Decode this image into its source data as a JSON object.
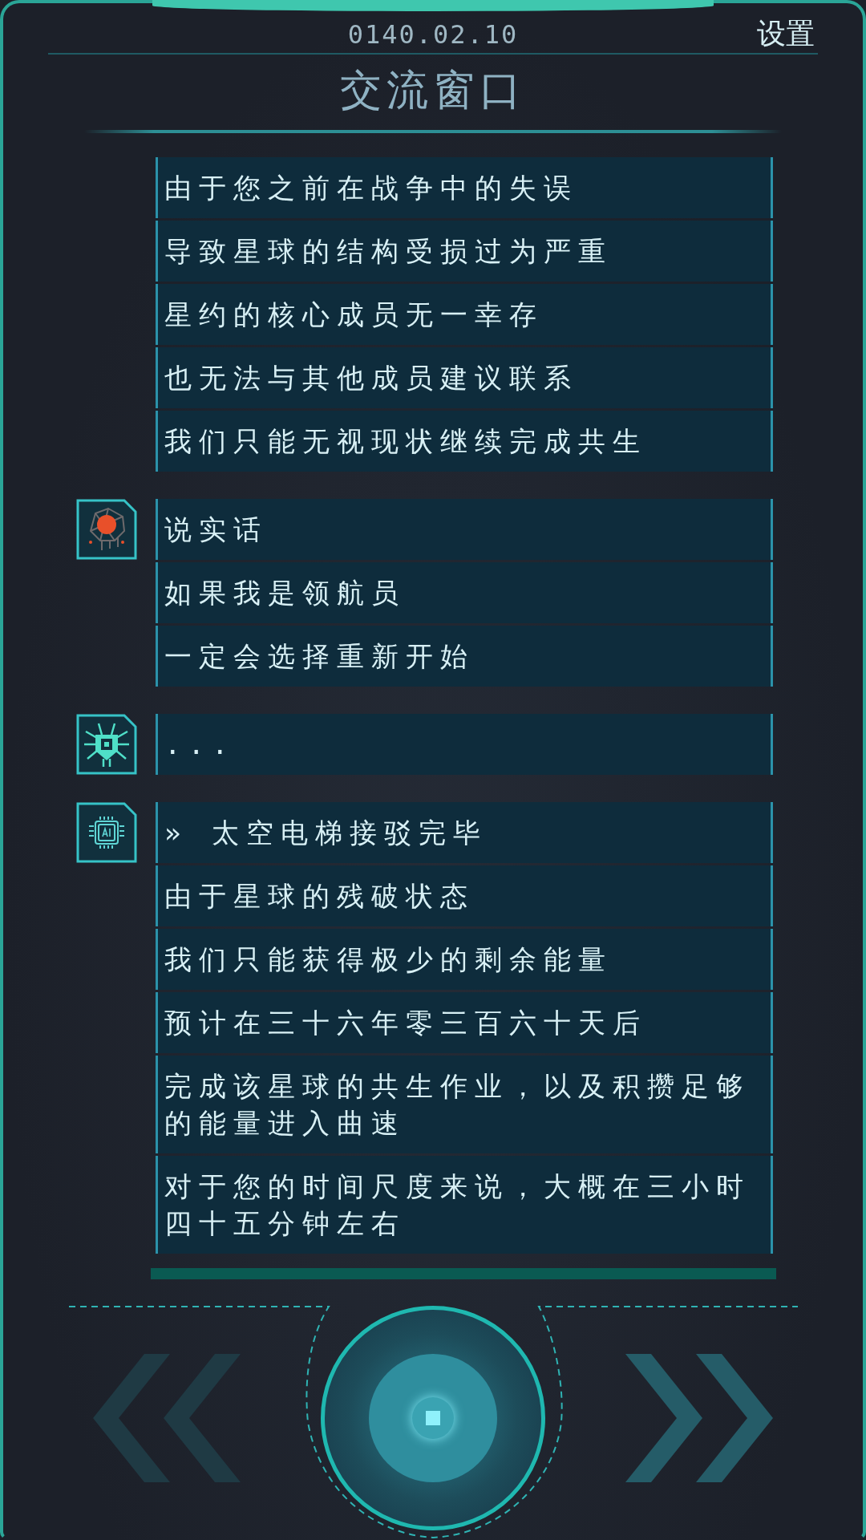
{
  "header": {
    "date": "0140.02.10",
    "settings": "设置",
    "title": "交流窗口"
  },
  "groups": [
    {
      "kind": "continued",
      "lines": [
        "由于您之前在战争中的失误",
        "导致星球的结构受损过为严重",
        "星约的核心成员无一幸存",
        "也无法与其他成员建议联系",
        "我们只能无视现状继续完成共生"
      ]
    },
    {
      "kind": "brain",
      "lines": [
        "说实话",
        "如果我是领航员",
        "一定会选择重新开始"
      ]
    },
    {
      "kind": "bug",
      "lines": [
        "..."
      ]
    },
    {
      "kind": "chip",
      "lines": [
        "» 太空电梯接驳完毕",
        "由于星球的残破状态",
        "我们只能获得极少的剩余能量",
        "预计在三十六年零三百六十天后",
        "完成该星球的共生作业，以及积攒足够的能量进入曲速",
        "对于您的时间尺度来说，大概在三小时四十五分钟左右"
      ]
    }
  ],
  "controls": {
    "previous": {
      "disabled": true
    },
    "next": {
      "disabled": false
    }
  }
}
